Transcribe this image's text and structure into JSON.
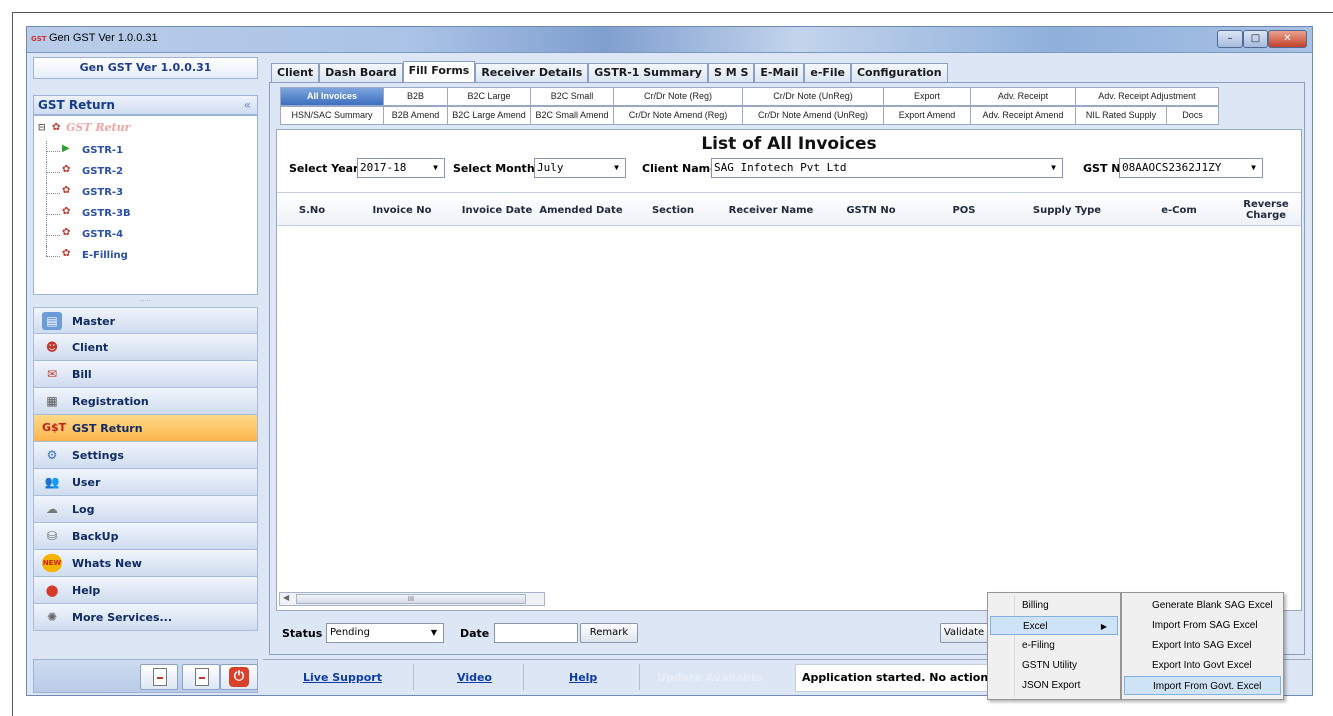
{
  "window": {
    "title": "Gen GST  Ver 1.0.0.31",
    "app_icon": "GST"
  },
  "left": {
    "version_label": "Gen GST  Ver 1.0.0.31",
    "gst_return_header": "GST Return",
    "collapse_glyph": "«",
    "tree": {
      "root": "GST Retur",
      "items": [
        "GSTR-1",
        "GSTR-2",
        "GSTR-3",
        "GSTR-3B",
        "GSTR-4",
        "E-Filling"
      ]
    },
    "nav": [
      "Master",
      "Client",
      "Bill",
      "Registration",
      "GST Return",
      "Settings",
      "User",
      "Log",
      "BackUp",
      "Whats New",
      "Help",
      "More Services..."
    ]
  },
  "main": {
    "top_tabs": [
      "Client",
      "Dash Board",
      "Fill Forms",
      "Receiver Details",
      "GSTR-1 Summary",
      "S M S",
      "E-Mail",
      "e-File",
      "Configuration"
    ],
    "sub_tabs_row1": [
      "All Invoices",
      "B2B",
      "B2C Large",
      "B2C Small",
      "Cr/Dr Note (Reg)",
      "Cr/Dr Note (UnReg)",
      "Export",
      "Adv. Receipt",
      "Adv. Receipt Adjustment"
    ],
    "sub_tabs_row2": [
      "HSN/SAC Summary",
      "B2B Amend",
      "B2C Large Amend",
      "B2C Small Amend",
      "Cr/Dr Note Amend (Reg)",
      "Cr/Dr Note Amend (UnReg)",
      "Export Amend",
      "Adv. Receipt Amend",
      "NIL Rated Supply",
      "Docs"
    ],
    "list_title": "List of All Invoices",
    "filters": {
      "year_label": "Select Year",
      "year_value": "2017-18",
      "month_label": "Select Month",
      "month_value": "July",
      "client_label": "Client Name",
      "client_value": "SAG Infotech Pvt Ltd",
      "gst_label": "GST No",
      "gst_value": "08AAOCS2362J1ZY"
    },
    "columns": [
      "S.No",
      "Invoice No",
      "Invoice Date",
      "Amended Date",
      "Section",
      "Receiver Name",
      "GSTN No",
      "POS",
      "Supply Type",
      "e-Com",
      "Reverse Charge"
    ],
    "status": {
      "status_label": "Status",
      "status_value": "Pending",
      "date_label": "Date",
      "date_value": "",
      "remark_button": "Remark",
      "validate_button": "Validate"
    }
  },
  "bottom": {
    "live_support": "Live Support",
    "video": "Video",
    "help": "Help",
    "update": "Update Available",
    "status_message": "Application started. No action yet"
  },
  "menu": {
    "primary": [
      "Billing",
      "Excel",
      "e-Filing",
      "GSTN Utility",
      "JSON Export"
    ],
    "excel_submenu": [
      "Generate Blank SAG Excel",
      "Import From SAG Excel",
      "Export Into SAG Excel",
      "Export Into Govt Excel",
      "Import From Govt. Excel"
    ]
  },
  "colors": {
    "accent": "#3c6fc0",
    "active_nav": "#fbb64c",
    "window_bg": "#dce6f4"
  }
}
